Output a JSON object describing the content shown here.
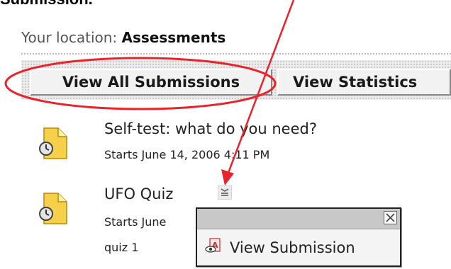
{
  "caption": "Submission.",
  "location": {
    "label": "Your location:",
    "value": "Assessments"
  },
  "toolbar": {
    "view_all_label": "View All Submissions",
    "view_stats_label": "View Statistics"
  },
  "items": [
    {
      "title": "Self-test: what do you need?",
      "subtitle": "Starts June 14, 2006 4:11 PM",
      "icon": "quiz-clock-document-icon"
    },
    {
      "title": "UFO Quiz",
      "subtitle": "Starts June",
      "note": "quiz 1",
      "icon": "quiz-clock-document-icon"
    }
  ],
  "popup": {
    "item_label": "View Submission",
    "close_icon": "close-icon",
    "item_icon": "view-submission-icon"
  },
  "colors": {
    "annotation_red": "#e8232b",
    "toolbar_bg": "#ececec",
    "button_face": "#f2f2f2",
    "popup_header": "#c8c8c8"
  }
}
